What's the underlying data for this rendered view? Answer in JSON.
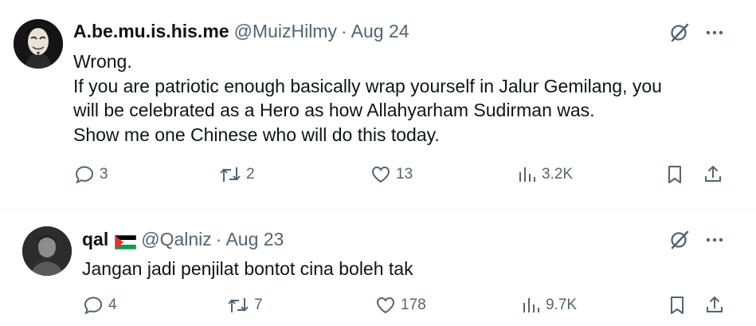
{
  "tweets": [
    {
      "name": "A.be.mu.is.his.me",
      "handle": "@MuizHilmy",
      "separator": "·",
      "date": "Aug 24",
      "lines": [
        "Wrong.",
        "If you are patriotic enough basically wrap yourself in Jalur Gemilang, you",
        "will be celebrated as a Hero as how Allahyarham Sudirman was.",
        "Show me one Chinese who will do this today."
      ],
      "replies": "3",
      "reposts": "2",
      "likes": "13",
      "views": "3.2K"
    },
    {
      "name": "qal",
      "handle": "@Qalniz",
      "separator": "·",
      "date": "Aug 23",
      "lines": [
        "Jangan jadi penjilat bontot cina boleh tak"
      ],
      "replies": "4",
      "reposts": "7",
      "likes": "178",
      "views": "9.7K"
    }
  ],
  "icons": {
    "reply": "reply-icon",
    "repost": "repost-icon",
    "like": "heart-icon",
    "views": "views-icon",
    "bookmark": "bookmark-icon",
    "share": "share-icon",
    "grok": "grok-icon",
    "more": "more-icon",
    "flag": "palestine-flag-icon"
  },
  "colors": {
    "text": "#0f1419",
    "secondary": "#536471",
    "divider": "#eff3f4"
  }
}
